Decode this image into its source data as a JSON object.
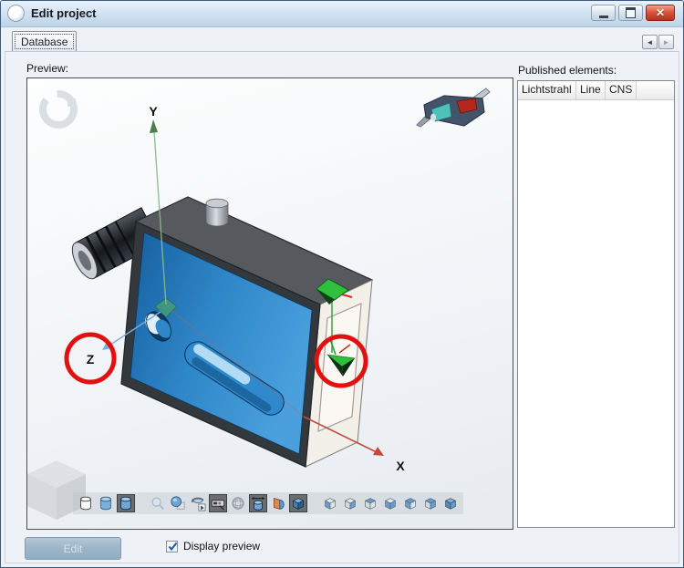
{
  "window": {
    "title": "Edit project"
  },
  "tabs": [
    {
      "label": "Database",
      "active": true
    }
  ],
  "nav": {
    "left_arrow": "◄",
    "right_arrow": "►"
  },
  "preview": {
    "label": "Preview:"
  },
  "axes": {
    "x": "X",
    "y": "Y",
    "z": "Z"
  },
  "published": {
    "label": "Published elements:",
    "columns": [
      "Lichtstrahl",
      "Line",
      "CNS"
    ],
    "rows": []
  },
  "toolbar": {
    "buttons": [
      {
        "name": "wireframe-cylinder",
        "pressed": false
      },
      {
        "name": "shaded-cylinder",
        "pressed": false
      },
      {
        "name": "shaded-edges-cylinder",
        "pressed": true
      },
      {
        "name": "zoom-tool",
        "pressed": false
      },
      {
        "name": "rotate-sphere",
        "pressed": false
      },
      {
        "name": "spin-animation",
        "pressed": false
      },
      {
        "name": "measure-device",
        "pressed": true
      },
      {
        "name": "mesh-display",
        "pressed": false
      },
      {
        "name": "pan-cylinder",
        "pressed": true
      },
      {
        "name": "section-view",
        "pressed": false
      },
      {
        "name": "solid-cube",
        "pressed": true
      },
      {
        "name": "view-cube-1",
        "pressed": false
      },
      {
        "name": "view-cube-2",
        "pressed": false
      },
      {
        "name": "view-cube-3",
        "pressed": false
      },
      {
        "name": "view-cube-4",
        "pressed": false
      },
      {
        "name": "view-cube-5",
        "pressed": false
      },
      {
        "name": "view-cube-6",
        "pressed": false
      },
      {
        "name": "view-cube-7",
        "pressed": false
      }
    ]
  },
  "footer": {
    "edit": "Edit",
    "edit_enabled": false,
    "display_preview": "Display preview",
    "display_preview_checked": true
  },
  "colors": {
    "highlight_red": "#e21111",
    "part_blue": "#2e89cd",
    "axis_x": "#bf4a3a",
    "axis_y": "#6aa06a",
    "axis_z": "#79aede",
    "titlebar": "#cfe0f0",
    "close_red": "#d9503a"
  }
}
